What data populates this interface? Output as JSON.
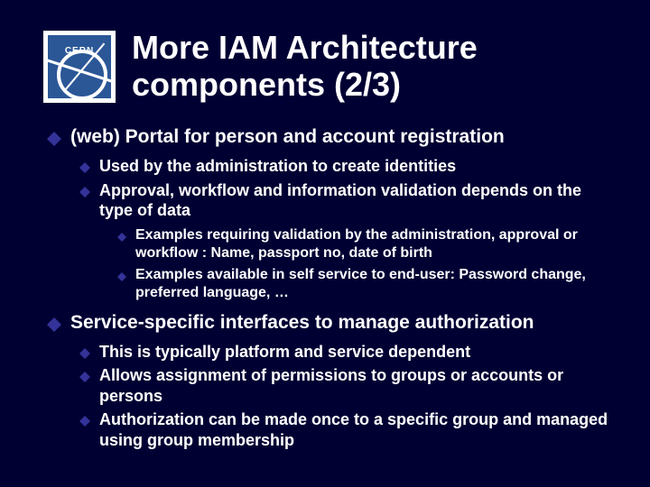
{
  "logo": {
    "text": "CERN"
  },
  "title": "More IAM Architecture components (2/3)",
  "items": [
    {
      "text": "(web) Portal for person and account registration",
      "children": [
        {
          "text": "Used by the administration to create identities"
        },
        {
          "text": "Approval, workflow and information validation depends on the type of data",
          "children": [
            {
              "text": "Examples requiring validation by the administration, approval or workflow : Name, passport no, date of birth"
            },
            {
              "text": "Examples available in self service to end-user: Password change, preferred language, …"
            }
          ]
        }
      ]
    },
    {
      "text": "Service-specific interfaces to manage authorization",
      "children": [
        {
          "text": "This is typically platform and service dependent"
        },
        {
          "text": "Allows assignment of permissions to groups  or accounts or persons"
        },
        {
          "text": "Authorization can be made once to a specific group and managed using group membership"
        }
      ]
    }
  ]
}
